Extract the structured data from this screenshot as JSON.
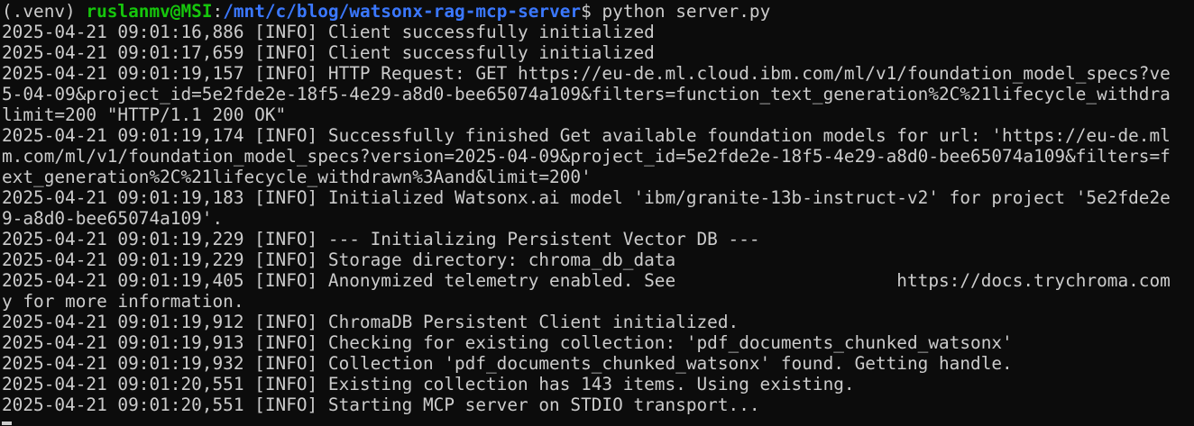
{
  "prompt": {
    "venv": "(.venv) ",
    "user_host": "ruslanmv@MSI",
    "separator": ":",
    "path": "/mnt/c/blog/watsonx-rag-mcp-server",
    "dollar": "$ ",
    "command": "python server.py"
  },
  "output_lines": [
    "2025-04-21 09:01:16,886 [INFO] Client successfully initialized",
    "2025-04-21 09:01:17,659 [INFO] Client successfully initialized",
    "2025-04-21 09:01:19,157 [INFO] HTTP Request: GET https://eu-de.ml.cloud.ibm.com/ml/v1/foundation_model_specs?ve",
    "5-04-09&project_id=5e2fde2e-18f5-4e29-a8d0-bee65074a109&filters=function_text_generation%2C%21lifecycle_withdra",
    "limit=200 \"HTTP/1.1 200 OK\"",
    "2025-04-21 09:01:19,174 [INFO] Successfully finished Get available foundation models for url: 'https://eu-de.ml",
    "m.com/ml/v1/foundation_model_specs?version=2025-04-09&project_id=5e2fde2e-18f5-4e29-a8d0-bee65074a109&filters=f",
    "ext_generation%2C%21lifecycle_withdrawn%3Aand&limit=200'",
    "2025-04-21 09:01:19,183 [INFO] Initialized Watsonx.ai model 'ibm/granite-13b-instruct-v2' for project '5e2fde2e",
    "9-a8d0-bee65074a109'.",
    "2025-04-21 09:01:19,229 [INFO] --- Initializing Persistent Vector DB ---",
    "2025-04-21 09:01:19,229 [INFO] Storage directory: chroma_db_data",
    "2025-04-21 09:01:19,405 [INFO] Anonymized telemetry enabled. See                     https://docs.trychroma.com",
    "y for more information.",
    "2025-04-21 09:01:19,912 [INFO] ChromaDB Persistent Client initialized.",
    "2025-04-21 09:01:19,913 [INFO] Checking for existing collection: 'pdf_documents_chunked_watsonx'",
    "2025-04-21 09:01:19,932 [INFO] Collection 'pdf_documents_chunked_watsonx' found. Getting handle.",
    "2025-04-21 09:01:20,551 [INFO] Existing collection has 143 items. Using existing.",
    "2025-04-21 09:01:20,551 [INFO] Starting MCP server on STDIO transport..."
  ],
  "colors": {
    "background": "#0c0c0c",
    "text": "#cccccc",
    "user_host": "#16c60c",
    "path": "#3b78ff"
  }
}
